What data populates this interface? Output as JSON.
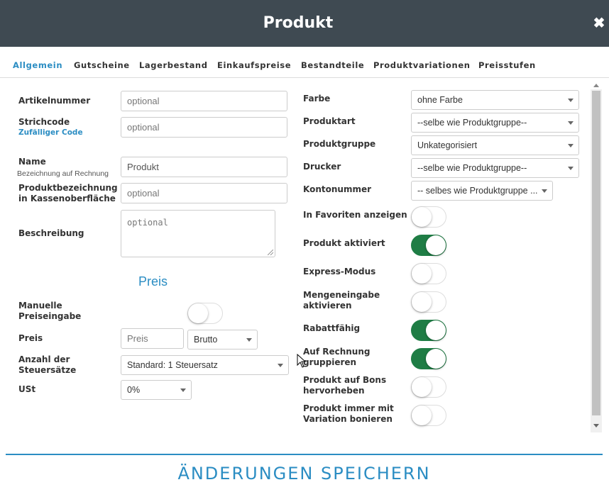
{
  "header": {
    "title": "Produkt",
    "close_icon": "close-icon"
  },
  "tabs": [
    {
      "label": "Allgemein",
      "active": true
    },
    {
      "label": "Gutscheine",
      "active": false
    },
    {
      "label": "Lagerbestand",
      "active": false
    },
    {
      "label": "Einkaufspreise",
      "active": false
    },
    {
      "label": "Bestandteile",
      "active": false
    },
    {
      "label": "Produktvariationen",
      "active": false
    },
    {
      "label": "Preisstufen",
      "active": false
    }
  ],
  "left": {
    "artikelnummer": {
      "label": "Artikelnummer",
      "placeholder": "optional"
    },
    "strichcode": {
      "label": "Strichcode",
      "link": "Zufälliger Code",
      "placeholder": "optional"
    },
    "name": {
      "label": "Name",
      "sublabel": "Bezeichnung auf Rechnung",
      "value": "Produkt"
    },
    "kassen": {
      "label_line1": "Produktbezeichnung",
      "label_line2": "in Kassenoberfläche",
      "placeholder": "optional"
    },
    "beschreibung": {
      "label": "Beschreibung",
      "placeholder": "optional"
    },
    "preis_section": "Preis",
    "manuelle": {
      "label_line1": "Manuelle",
      "label_line2": "Preiseingabe",
      "on": false
    },
    "preis": {
      "label": "Preis",
      "placeholder": "Preis",
      "mode": "Brutto"
    },
    "steuer": {
      "label_line1": "Anzahl der",
      "label_line2": "Steuersätze",
      "value": "Standard: 1 Steuersatz"
    },
    "ust": {
      "label": "USt",
      "value": "0%"
    }
  },
  "right": {
    "farbe": {
      "label": "Farbe",
      "value": "ohne Farbe"
    },
    "produktart": {
      "label": "Produktart",
      "value": "--selbe wie Produktgruppe--"
    },
    "produktgruppe": {
      "label": "Produktgruppe",
      "value": "Unkategorisiert"
    },
    "drucker": {
      "label": "Drucker",
      "value": "--selbe wie Produktgruppe--"
    },
    "kontonummer": {
      "label": "Kontonummer",
      "value": "-- selbes wie Produktgruppe ..."
    },
    "toggles": [
      {
        "label_line1": "In Favoriten anzeigen",
        "label_line2": "",
        "on": false
      },
      {
        "label_line1": "Produkt aktiviert",
        "label_line2": "",
        "on": true
      },
      {
        "label_line1": "Express-Modus",
        "label_line2": "",
        "on": false
      },
      {
        "label_line1": "Mengeneingabe",
        "label_line2": "aktivieren",
        "on": false
      },
      {
        "label_line1": "Rabattfähig",
        "label_line2": "",
        "on": true
      },
      {
        "label_line1": "Auf Rechnung",
        "label_line2": "gruppieren",
        "on": true
      },
      {
        "label_line1": "Produkt auf Bons",
        "label_line2": "hervorheben",
        "on": false
      },
      {
        "label_line1": "Produkt immer mit",
        "label_line2": "Variation bonieren",
        "on": false
      }
    ]
  },
  "footer": {
    "save_label": "ÄNDERUNGEN SPEICHERN"
  },
  "colors": {
    "header_bg": "#3f4a52",
    "accent": "#2b8dc3",
    "toggle_on": "#1f7d45"
  }
}
